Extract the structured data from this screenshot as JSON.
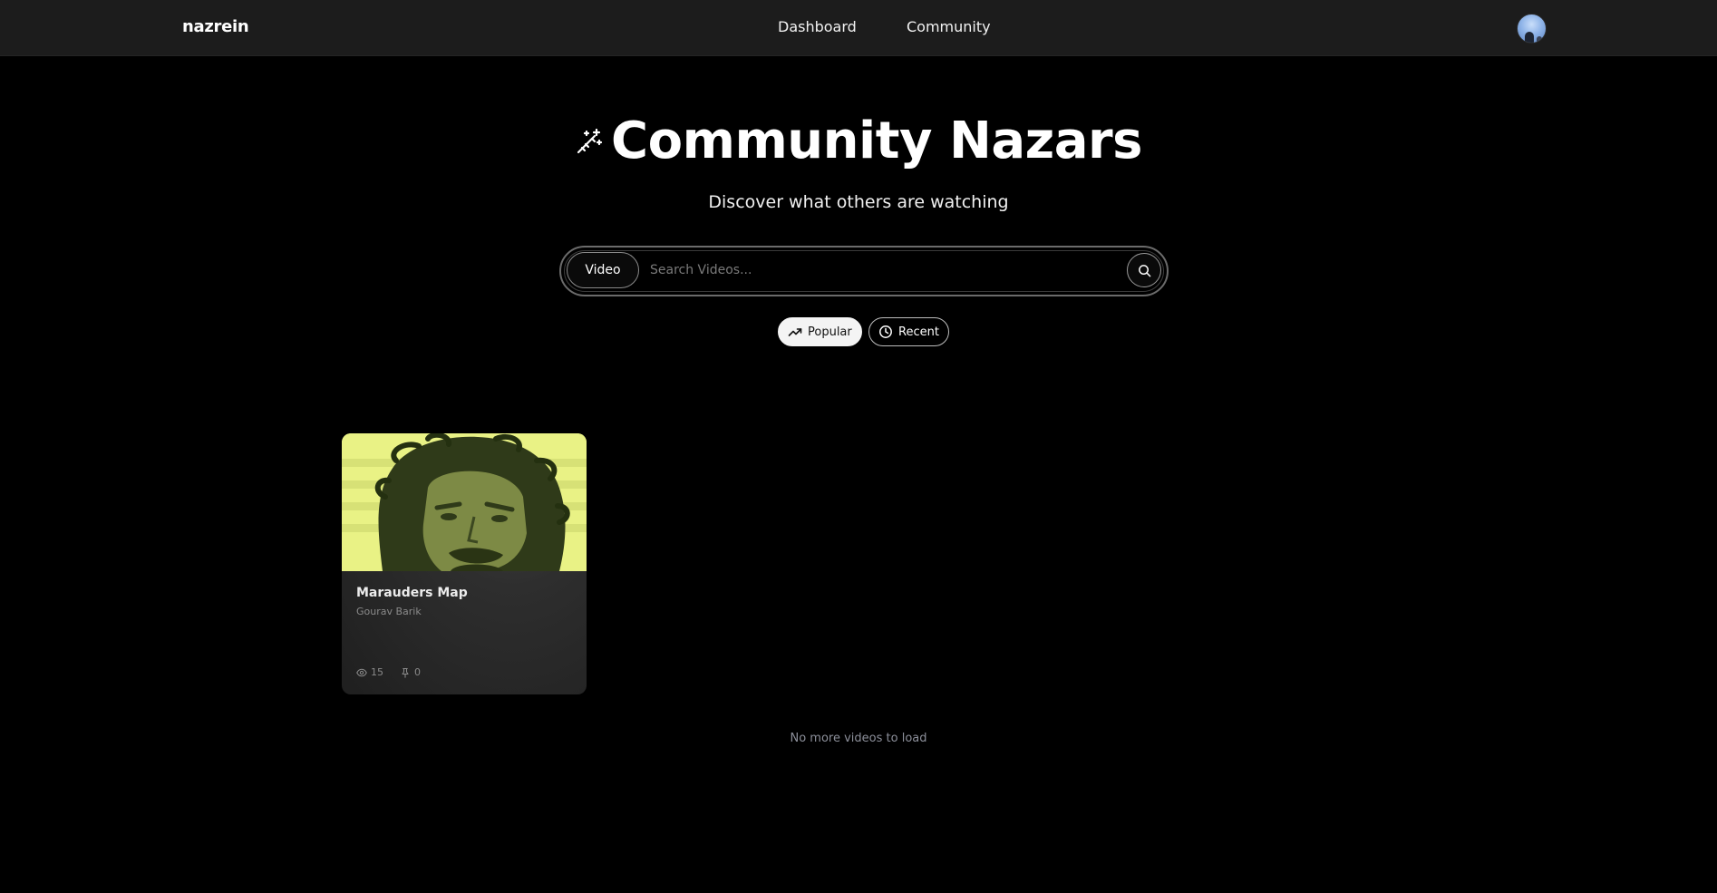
{
  "header": {
    "brand": "nazrein",
    "nav": [
      {
        "label": "Dashboard"
      },
      {
        "label": "Community"
      }
    ]
  },
  "hero": {
    "title": "Community Nazars",
    "subtitle": "Discover what others are watching",
    "icon": "magic-wand-icon"
  },
  "search": {
    "type_label": "Video",
    "placeholder": "Search Videos...",
    "value": ""
  },
  "filters": [
    {
      "label": "Popular",
      "icon": "trending-up-icon",
      "active": true
    },
    {
      "label": "Recent",
      "icon": "clock-icon",
      "active": false
    }
  ],
  "videos": [
    {
      "title": "Marauders Map",
      "author": "Gourav Barik",
      "views": "15",
      "pins": "0"
    }
  ],
  "footer_note": "No more videos to load",
  "colors": {
    "background": "#000000",
    "topbar": "#1c1c1c",
    "thumbnail_tint": "#e9f285"
  }
}
